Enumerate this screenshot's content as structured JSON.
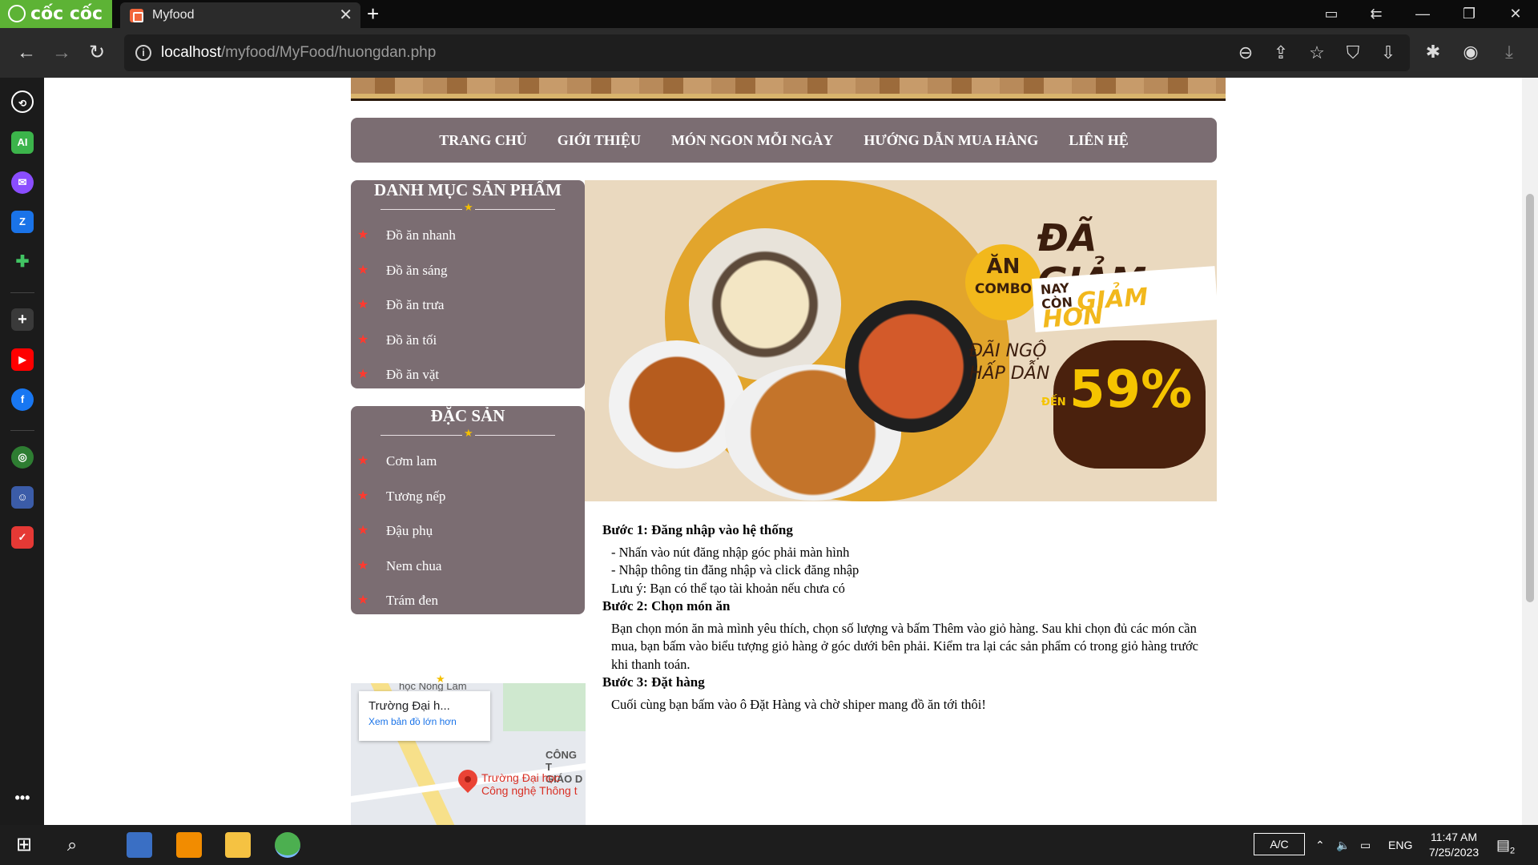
{
  "browser": {
    "brand": "cốc cốc",
    "tab_title": "Myfood",
    "tab_close": "✕",
    "new_tab": "+",
    "url_host": "localhost",
    "url_path": "/myfood/MyFood/huongdan.php"
  },
  "menu": [
    "TRANG CHỦ",
    "GIỚI THIỆU",
    "MÓN NGON MỖI NGÀY",
    "HƯỚNG DẪN MUA HÀNG",
    "LIÊN HỆ"
  ],
  "categories": {
    "title": "DANH MỤC SẢN PHẨM",
    "items": [
      "Đồ ăn nhanh",
      "Đồ ăn sáng",
      "Đồ ăn trưa",
      "Đồ ăn tối",
      "Đồ ăn vặt"
    ]
  },
  "specialties": {
    "title": "ĐẶC SẢN",
    "items": [
      "Cơm lam",
      "Tương nếp",
      "Đậu phụ",
      "Nem chua",
      "Trám đen"
    ]
  },
  "map": {
    "place_name": "Trường Đại h...",
    "larger_map": "Xem bản đồ lớn hơn",
    "pin_label_1": "Trường Đại học",
    "pin_label_2": "Công nghệ Thông t",
    "side_label_1": "CÔNG T",
    "side_label_2": "GIÁO D",
    "top_label": "học Nông Lâm"
  },
  "banner": {
    "tag_big": "ĂN",
    "tag_small": "COMBO",
    "headline": "ĐÃ GIẢM",
    "sub_prefix_1": "NAY",
    "sub_prefix_2": "CÒN",
    "sub_em": "GIẢM HƠN",
    "offer_1": "ĐÃI NGỘ",
    "offer_2": "HẤP DẪN",
    "upto": "ĐẾN",
    "percent": "59%"
  },
  "guide": {
    "step1_title": "Bước 1: Đăng nhập vào hệ thống",
    "step1_line1": "- Nhấn vào nút đăng nhập góc phải màn hình",
    "step1_line2": "- Nhập thông tin đăng nhập và click đăng nhập",
    "step1_note": "Lưu ý: Bạn có thể tạo tài khoản nếu chưa có",
    "step2_title": "Bước 2: Chọn món ăn",
    "step2_text": "Bạn chọn món ăn mà mình yêu thích, chọn số lượng và bấm Thêm vào giỏ hàng. Sau khi chọn đủ các món cần mua, bạn bấm vào biểu tượng giỏ hàng ở góc dưới bên phải. Kiểm tra lại các sản phẩm có trong giỏ hàng trước khi thanh toán.",
    "step3_title": "Bước 3: Đặt hàng",
    "step3_text": "Cuối cùng bạn bấm vào ô Đặt Hàng và chờ shiper mang đồ ăn tới thôi!"
  },
  "taskbar": {
    "ac_label": "A/C",
    "lang": "ENG",
    "time": "11:47 AM",
    "date": "7/25/2023",
    "notif_count": "2"
  },
  "colors": {
    "panel": "#7b6d72",
    "star_yellow": "#f5c000",
    "star_red": "#ff3a2f"
  }
}
